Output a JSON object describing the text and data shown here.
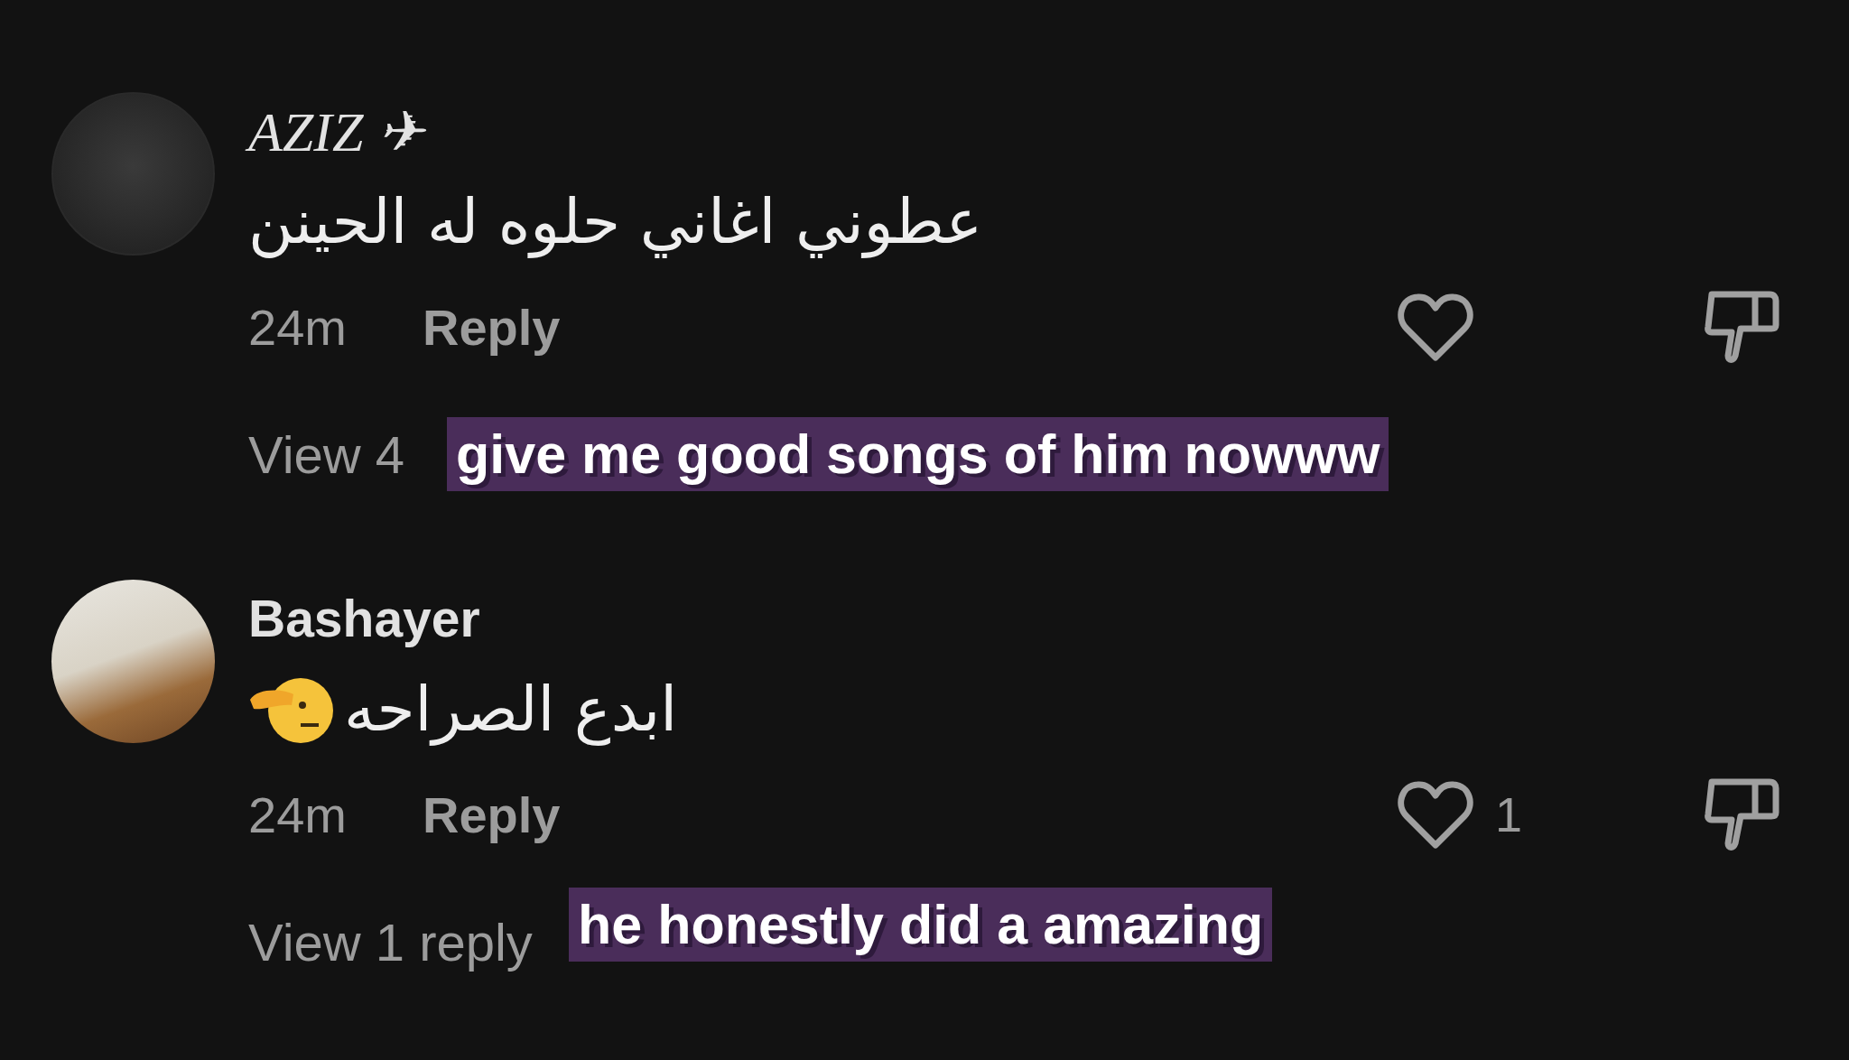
{
  "comments": [
    {
      "kind": "stylized",
      "username": "AZIZ ✈",
      "text": "عطوني اغاني حلوه له الحينن",
      "time": "24m",
      "reply_label": "Reply",
      "view_replies": "View 4",
      "caption": "give me good songs of him nowww"
    },
    {
      "kind": "emoji",
      "username": "Bashayer",
      "text": "ابدع الصراحه",
      "time": "24m",
      "reply_label": "Reply",
      "like_count": "1",
      "view_replies": "View 1 reply",
      "caption": "he honestly did a amazing"
    }
  ]
}
